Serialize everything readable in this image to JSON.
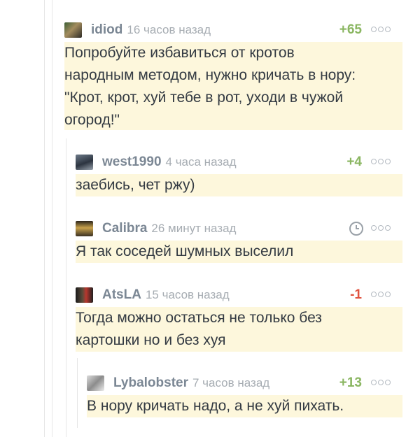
{
  "comments": [
    {
      "user": "idiod",
      "time": "16 часов назад",
      "rating": "+65",
      "text": [
        "Попробуйте избавиться от кротов",
        "народным методом, нужно кричать в нору:",
        "\"Крот, крот, хуй тебе в рот, уходи в чужой",
        "огород!\""
      ]
    },
    {
      "user": "west1990",
      "time": "4 часа назад",
      "rating": "+4",
      "text": [
        "заебись, чет ржу)"
      ]
    },
    {
      "user": "Calibra",
      "time": "26 минут назад",
      "rating": "",
      "text": [
        "Я так соседей шумных выселил"
      ]
    },
    {
      "user": "AtsLA",
      "time": "15 часов назад",
      "rating": "-1",
      "text": [
        "Тогда можно остаться не только без",
        "картошки но и без хуя"
      ]
    },
    {
      "user": "Lybalobster",
      "time": "7 часов назад",
      "rating": "+13",
      "text": [
        "В нору кричать надо, а не хуй пихать."
      ]
    }
  ],
  "colors": {
    "positive": "#8ab661",
    "negative": "#e0533f",
    "highlight": "#fdf7dc",
    "username": "#7b8794"
  },
  "icons": {
    "more": "three-dots-icon",
    "pending_rating": "clock-icon"
  }
}
